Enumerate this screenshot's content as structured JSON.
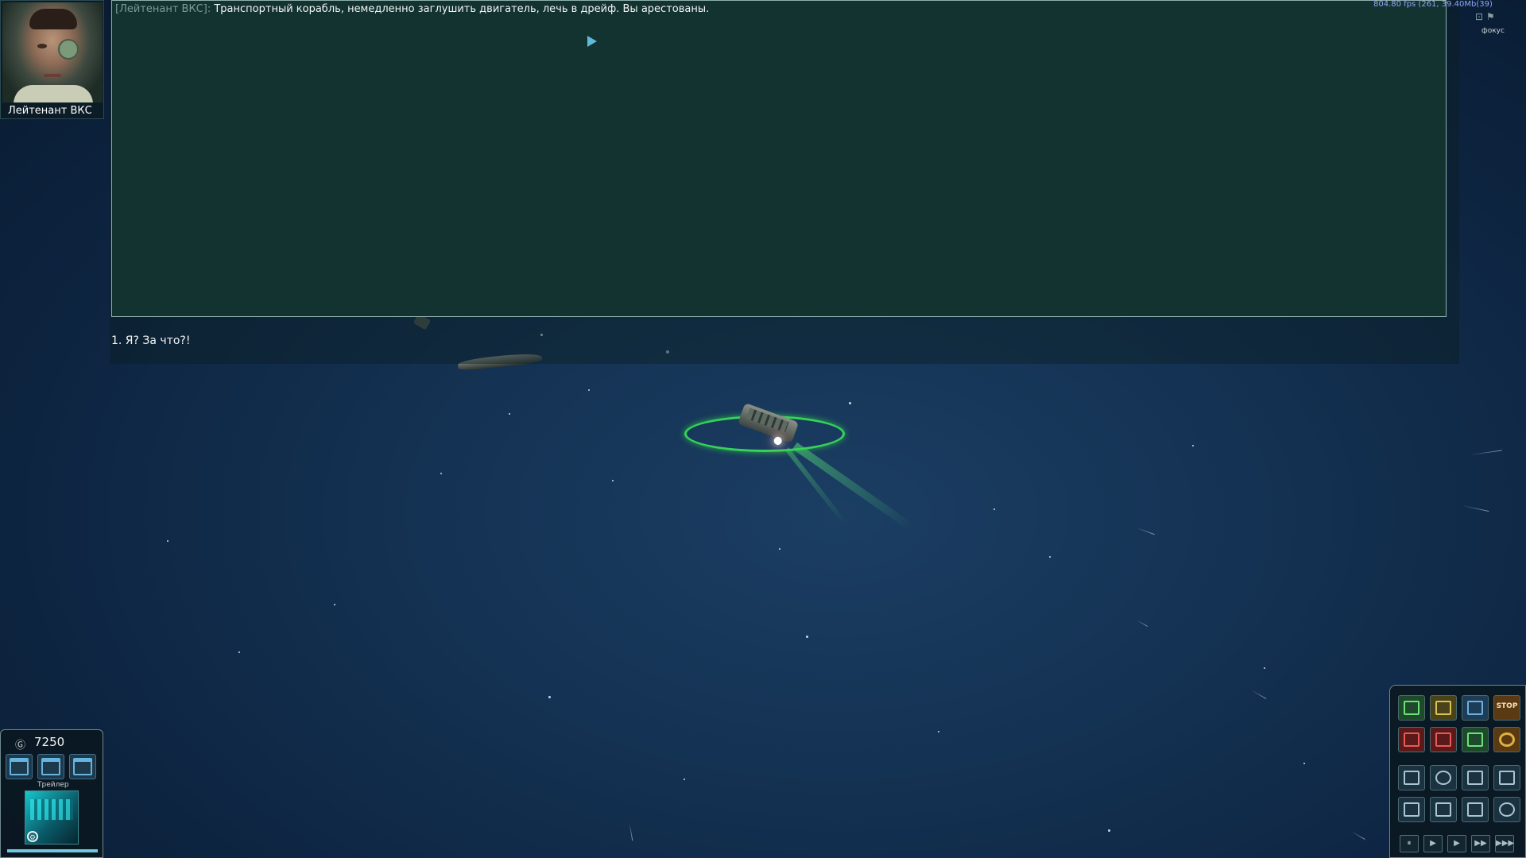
{
  "hud": {
    "fps_readout": "804.80 fps (261, 39.40Mb(39)",
    "focus_label": "фокус",
    "focus_icons": "⊡ ⚑"
  },
  "speaker": {
    "name": "Лейтенант ВКС",
    "portrait_icon": "portrait-image"
  },
  "dialog": {
    "speaker_tag": "[Лейтенант ВКС]:",
    "text": "Транспортный корабль, немедленно заглушить двигатель, лечь в дрейф. Вы арестованы.",
    "replies": [
      "1. Я? За что?!"
    ]
  },
  "cargo_panel": {
    "money_icon": "coin-icon",
    "money_glyph": "Ⓖ",
    "money": "7250",
    "trailer_label": "Трейлер",
    "trailer_gear_glyph": "⚙",
    "trailer_health_fraction": 1.0
  },
  "orders": {
    "stop_label": "STOP",
    "buttons": [
      "move-icon",
      "dock-icon",
      "undock-icon",
      "stop-icon",
      "attack-icon",
      "flee-icon",
      "trade-icon",
      "cancel-icon",
      "energy-icon",
      "search-icon",
      "list-icon",
      "route-icon",
      "log-icon",
      "mail-icon",
      "tree-icon",
      "network-icon"
    ],
    "speed": [
      "⏸",
      "▶",
      "▶",
      "▶▶",
      "▶▶▶"
    ]
  },
  "colors": {
    "space_bg": "#143253",
    "dialog_bg": "#123330",
    "selection_ring": "#35d35a",
    "speaker_tag": "#7e9a98",
    "fps_text": "#8fa6ff"
  }
}
